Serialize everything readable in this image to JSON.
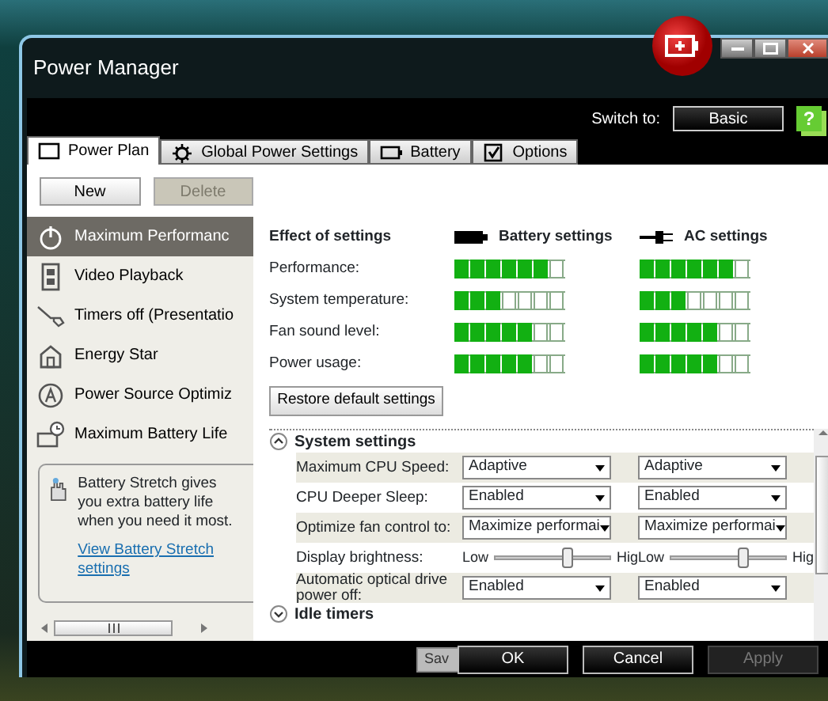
{
  "window": {
    "title": "Power Manager"
  },
  "header": {
    "switch_label": "Switch to:",
    "switch_button": "Basic",
    "help": "?"
  },
  "tabs": [
    {
      "label": "Power Plan",
      "selected": true
    },
    {
      "label": "Global Power Settings",
      "selected": false
    },
    {
      "label": "Battery",
      "selected": false
    },
    {
      "label": "Options",
      "selected": false
    }
  ],
  "plan_buttons": [
    {
      "label": "New",
      "disabled": false
    },
    {
      "label": "Delete",
      "disabled": true
    }
  ],
  "plans": [
    {
      "label": "Maximum Performanc",
      "selected": true
    },
    {
      "label": "Video Playback",
      "selected": false
    },
    {
      "label": "Timers off (Presentatio",
      "selected": false
    },
    {
      "label": "Energy Star",
      "selected": false
    },
    {
      "label": "Power Source Optimiz",
      "selected": false
    },
    {
      "label": "Maximum Battery Life",
      "selected": false
    }
  ],
  "battery_stretch": {
    "text": "Battery Stretch gives you extra battery life when you need it most.",
    "link": "View Battery Stretch settings"
  },
  "effect": {
    "heading": "Effect of settings",
    "columns": [
      "Battery settings",
      "AC settings"
    ],
    "rows": [
      {
        "label": "Performance:",
        "battery": {
          "level": 0.857
        },
        "ac": {
          "level": 0.857
        }
      },
      {
        "label": "System temperature:",
        "battery": {
          "level": 0.429
        },
        "ac": {
          "level": 0.429
        }
      },
      {
        "label": "Fan sound level:",
        "battery": {
          "level": 0.714
        },
        "ac": {
          "level": 0.714
        }
      },
      {
        "label": "Power usage:",
        "battery": {
          "level": 0.714
        },
        "ac": {
          "level": 0.714
        }
      }
    ]
  },
  "restore_button": "Restore default settings",
  "sections": [
    {
      "title": "System settings",
      "expanded": true,
      "settings": [
        {
          "kind": "dropdown",
          "label": "Maximum CPU Speed:",
          "battery": "Adaptive",
          "ac": "Adaptive"
        },
        {
          "kind": "dropdown",
          "label": "CPU Deeper Sleep:",
          "battery": "Enabled",
          "ac": "Enabled"
        },
        {
          "kind": "dropdown",
          "label": "Optimize fan control to:",
          "battery": "Maximize performai",
          "ac": "Maximize performai"
        },
        {
          "kind": "slider",
          "label": "Display brightness:",
          "battery": {
            "low": "Low",
            "high": "Hig",
            "level": 0.62
          },
          "ac": {
            "low": "Low",
            "high": "Hig",
            "level": 0.62
          }
        },
        {
          "kind": "dropdown",
          "label": "Automatic optical drive power off:",
          "battery": "Enabled",
          "ac": "Enabled"
        }
      ]
    },
    {
      "title": "Idle timers",
      "expanded": false
    }
  ],
  "background_button": "Sav",
  "footer_buttons": [
    {
      "label": "OK",
      "disabled": false
    },
    {
      "label": "Cancel",
      "disabled": false
    },
    {
      "label": "Apply",
      "disabled": true
    }
  ]
}
